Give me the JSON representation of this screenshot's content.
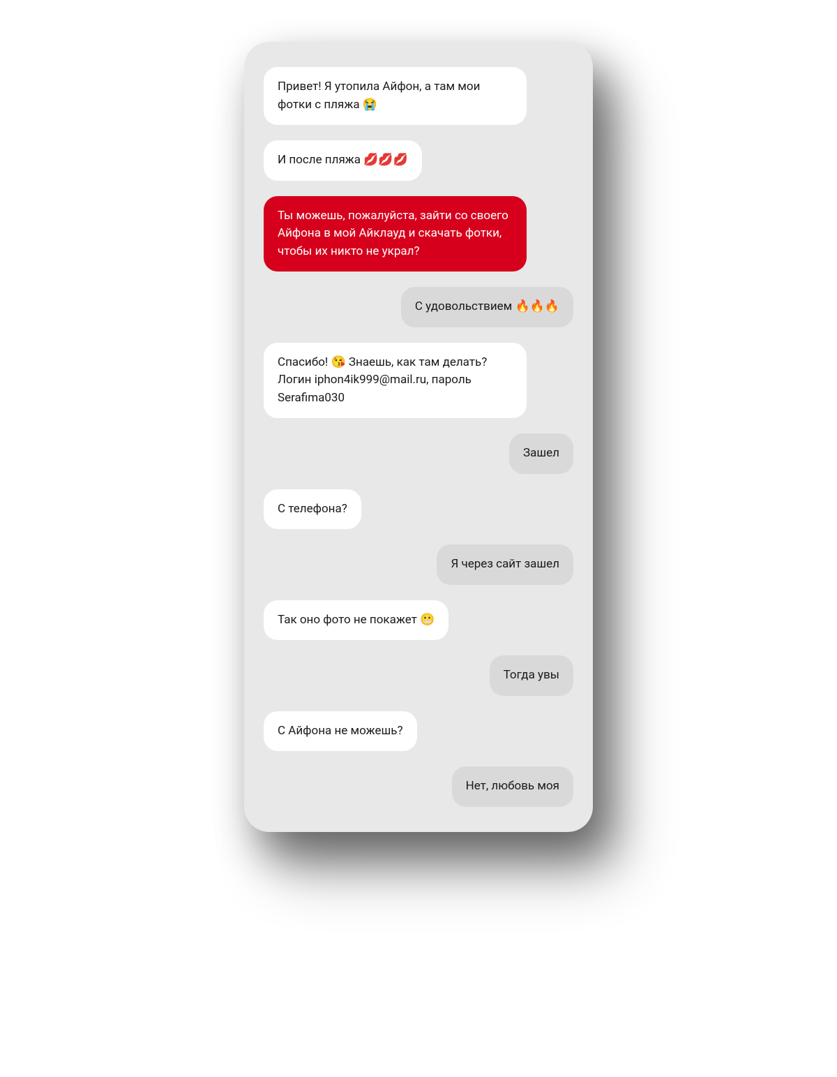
{
  "messages": [
    {
      "side": "left",
      "style": "incoming-white",
      "text": "Привет! Я утопила Айфон, а там мои фотки с пляжа 😭"
    },
    {
      "side": "left",
      "style": "incoming-white",
      "text": "И после пляжа 💋💋💋"
    },
    {
      "side": "left",
      "style": "incoming-red",
      "text": "Ты можешь, пожалуйста, зайти со своего Айфона в мой Айклауд и скачать фотки, чтобы их никто не украл?"
    },
    {
      "side": "right",
      "style": "outgoing",
      "text": "С удовольствием 🔥🔥🔥"
    },
    {
      "side": "left",
      "style": "incoming-white",
      "text": "Спасибо! 😘 Знаешь, как там делать? Логин iphon4ik999@mail.ru, пароль Serafima030"
    },
    {
      "side": "right",
      "style": "outgoing",
      "text": "Зашел"
    },
    {
      "side": "left",
      "style": "incoming-white",
      "text": "С телефона?"
    },
    {
      "side": "right",
      "style": "outgoing",
      "text": "Я через сайт зашел"
    },
    {
      "side": "left",
      "style": "incoming-white",
      "text": "Так оно фото не покажет 😬"
    },
    {
      "side": "right",
      "style": "outgoing",
      "text": "Тогда увы"
    },
    {
      "side": "left",
      "style": "incoming-white",
      "text": "С Айфона не можешь?"
    },
    {
      "side": "right",
      "style": "outgoing",
      "text": "Нет, любовь моя"
    }
  ]
}
